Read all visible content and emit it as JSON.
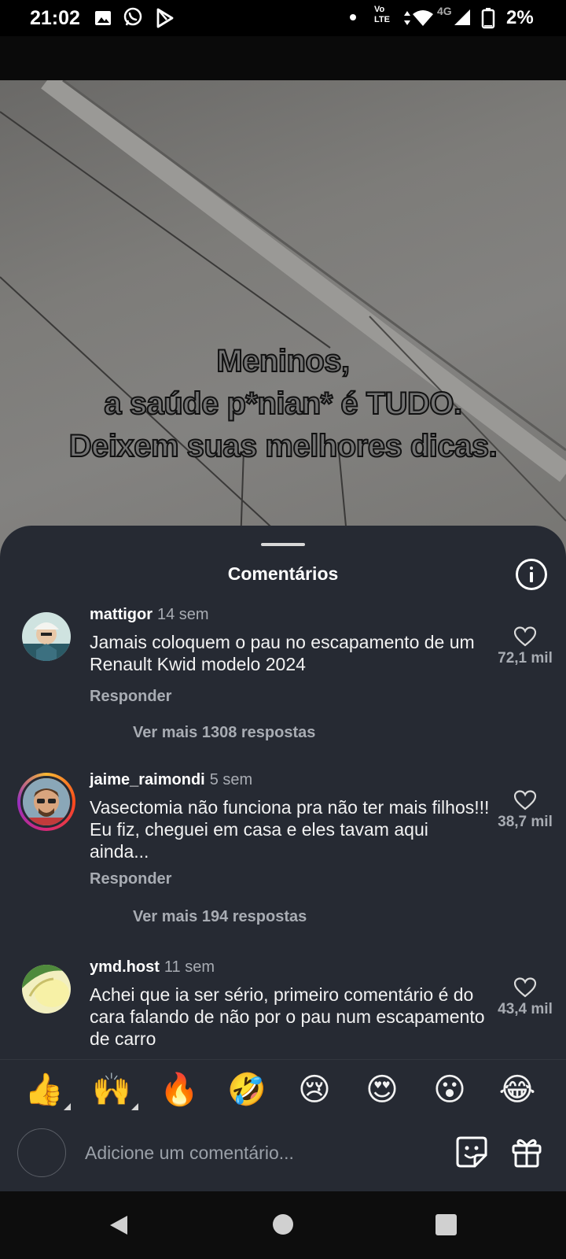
{
  "status_bar": {
    "time": "21:02",
    "left_icons": [
      "gallery-icon",
      "whatsapp-icon",
      "play-store-icon"
    ],
    "network_label_top": "Vo",
    "network_label_bottom": "LTE",
    "signal_label": "4G",
    "battery": "2%"
  },
  "video": {
    "overlay_lines": [
      "Meninos,",
      "a saúde p*nian* é TUDO.",
      "Deixem suas melhores dicas."
    ]
  },
  "sheet": {
    "title": "Comentários",
    "info_icon": "info-icon",
    "comments": [
      {
        "user": "mattigor",
        "time": "14 sem",
        "text": "Jamais coloquem o pau no escapamento de um Renault Kwid modelo 2024",
        "likes": "72,1 mil",
        "reply_label": "Responder",
        "more_replies": "Ver mais 1308 respostas"
      },
      {
        "user": "jaime_raimondi",
        "time": "5 sem",
        "text": "Vasectomia não funciona pra não ter mais filhos!!! Eu fiz, cheguei em casa e eles tavam aqui ainda...",
        "likes": "38,7 mil",
        "reply_label": "Responder",
        "more_replies": "Ver mais 194 respostas"
      },
      {
        "user": "ymd.host",
        "time": "11 sem",
        "text": "Achei que ia ser sério, primeiro comentário é do cara falando de não por o pau num escapamento de carro",
        "likes": "43,4 mil"
      }
    ]
  },
  "reactions": [
    "👍",
    "🙌",
    "🔥",
    "🤣",
    "😢",
    "😍",
    "😮",
    "😂"
  ],
  "composer": {
    "placeholder": "Adicione um comentário...",
    "sticker_icon": "sticker-icon",
    "gift_icon": "gift-icon"
  },
  "colors": {
    "sheet_bg": "#262a33",
    "muted_text": "#a8acb3",
    "status_bg": "#000000"
  }
}
